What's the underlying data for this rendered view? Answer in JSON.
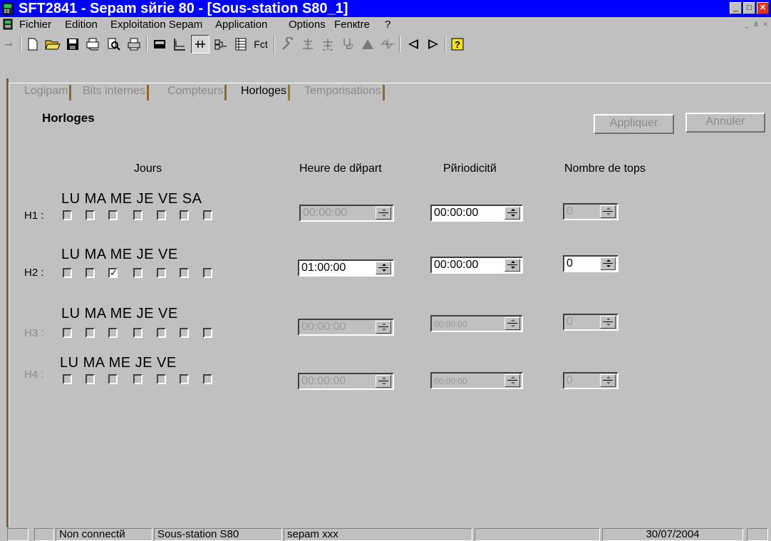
{
  "window": {
    "title": "SFT2841 - Sepam sйrie 80 - [Sous-station S80_1]",
    "minimize_glyph": "_",
    "maximize_glyph": "□",
    "close_glyph": "✕"
  },
  "menu": {
    "items": [
      "Fichier",
      "Edition",
      "Exploitation Sepam",
      "Application",
      "Options",
      "Fenкtre",
      "?"
    ],
    "mdi_min": "_",
    "mdi_restore": "ā",
    "mdi_close": "×"
  },
  "toolbar": {
    "icons": [
      "connect-icon",
      "new-file-icon",
      "open-folder-icon",
      "save-icon",
      "print-setup-icon",
      "print-preview-icon",
      "print-icon",
      "display-icon",
      "curve-icon",
      "io-icon",
      "logic-icon",
      "table-icon",
      "fct-icon",
      "wrench-icon",
      "network-icon",
      "tree-icon",
      "stethoscope-icon",
      "triangle-icon",
      "wave-icon",
      "arrow-left-icon",
      "arrow-right-icon",
      "help-icon"
    ],
    "fct_label": "Fct"
  },
  "tabs": {
    "items": [
      "Logipam",
      "Bits internes",
      "Compteurs",
      "Horloges",
      "Temporisations"
    ],
    "active": "Horloges"
  },
  "section": {
    "title": "Horloges",
    "apply_label": "Appliquer",
    "cancel_label": "Annuler"
  },
  "columns": {
    "days": "Jours",
    "start": "Heure de dйpart",
    "period": "Pйriodicitй",
    "tops": "Nombre de tops"
  },
  "rows": [
    {
      "label": "H1 :",
      "days": "LU  MA  ME  JE  VE  SA",
      "checked": [
        false,
        false,
        false,
        false,
        false,
        false,
        false
      ],
      "start": "00:00:00",
      "period": "00:00:00",
      "tops": "0"
    },
    {
      "label": "H2 :",
      "days": "LU   MA  ME  JE  VE",
      "checked": [
        false,
        false,
        true,
        false,
        false,
        false,
        false
      ],
      "start": "01:00:00",
      "period": "00:00:00",
      "tops": "0"
    },
    {
      "label": "H3 :",
      "days": "LU   MA  ME  JE  VE",
      "checked": [
        false,
        false,
        false,
        false,
        false,
        false,
        false
      ],
      "start": "00:00:00",
      "period": "00:00:00",
      "tops": "0"
    },
    {
      "label": "H4 :",
      "days": "LU   MA  ME  JE  VE",
      "checked": [
        false,
        false,
        false,
        false,
        false,
        false,
        false
      ],
      "start": "00:00:00",
      "period": "00:00:00",
      "tops": "0"
    }
  ],
  "status": {
    "connection": "Non connectй",
    "station": "Sous-station S80",
    "sepam": "sepam xxx",
    "date": "30/07/2004"
  },
  "colors": {
    "title_bar": "#0000ff",
    "face": "#c0c0c0",
    "disabled_text": "#8a8a8a"
  }
}
